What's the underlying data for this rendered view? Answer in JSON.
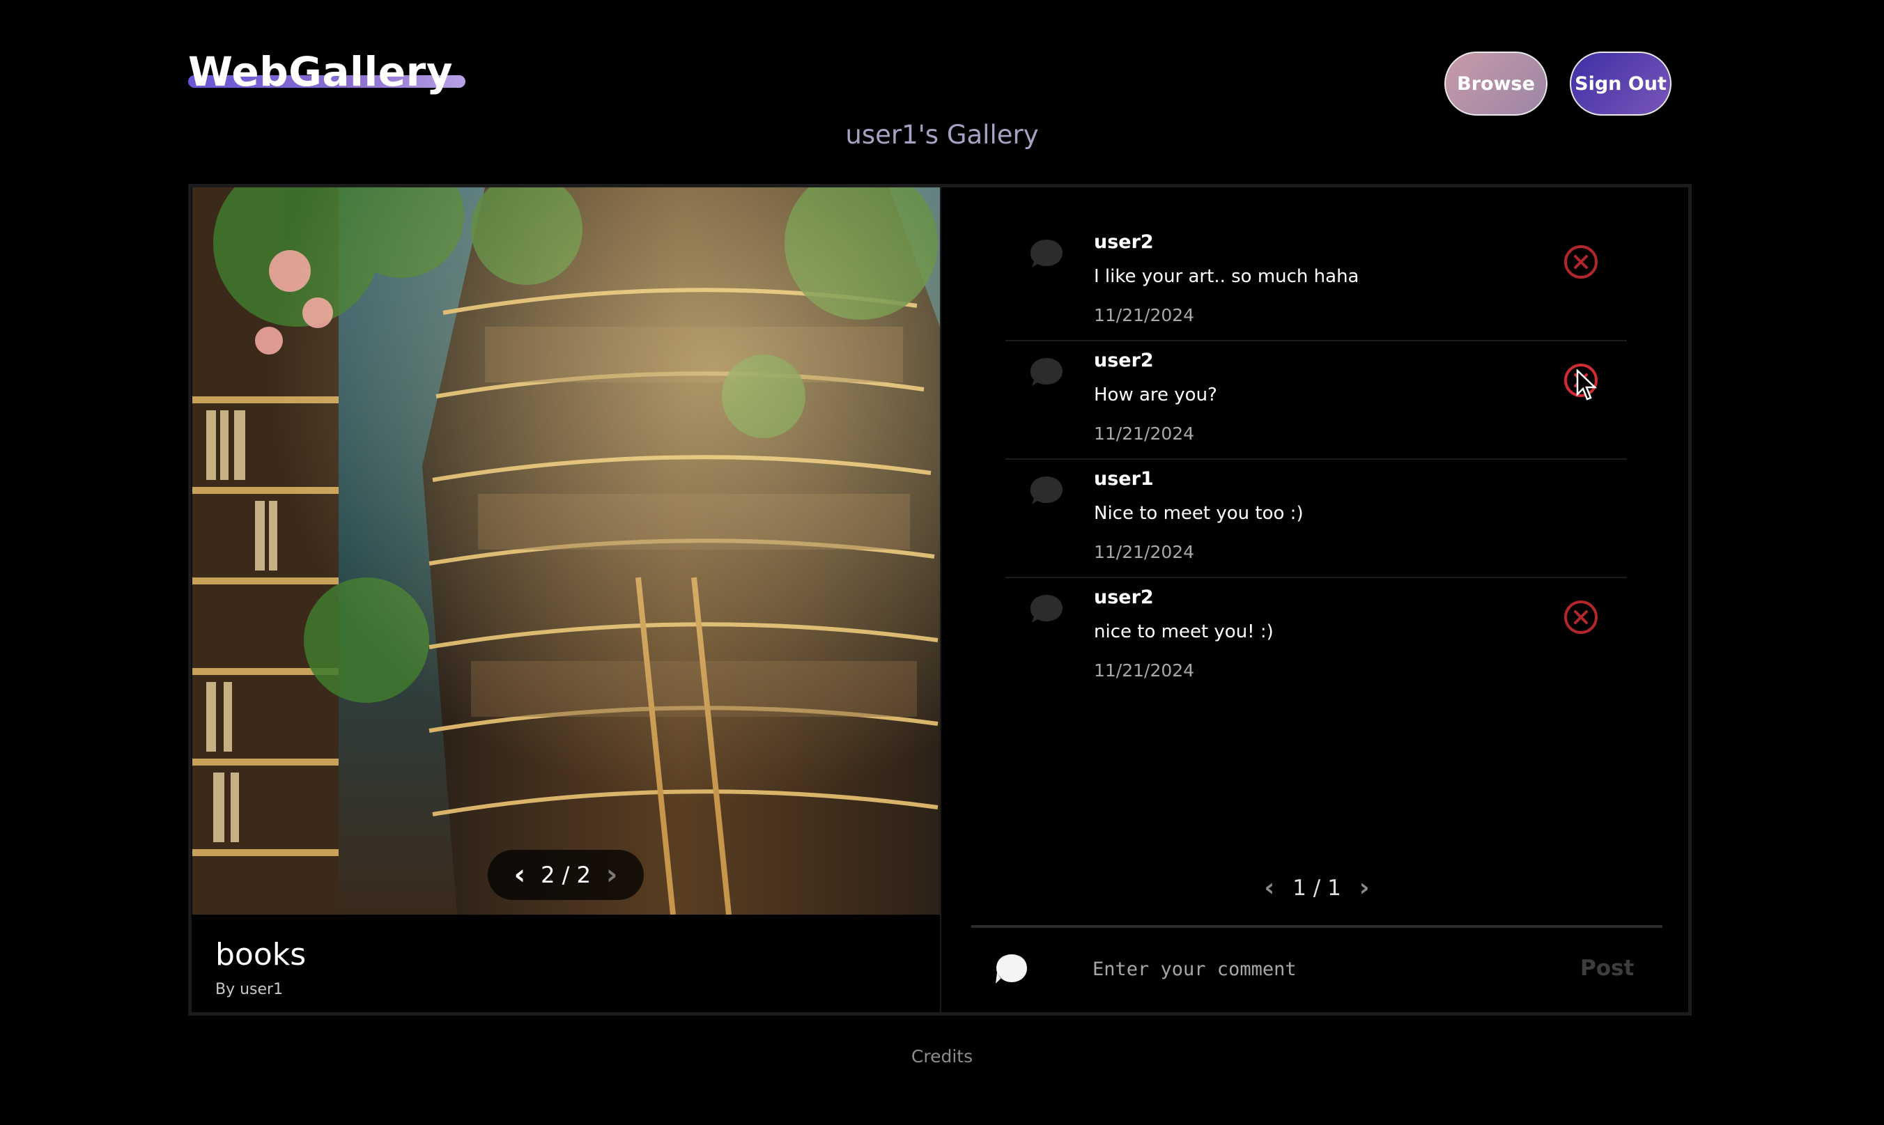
{
  "header": {
    "logo": "WebGallery",
    "browse_label": "Browse",
    "signout_label": "Sign Out",
    "gallery_title": "user1's Gallery"
  },
  "image": {
    "title": "books",
    "author": "By user1",
    "position": "2 / 2"
  },
  "comments": [
    {
      "author": "user2",
      "text": "I like your art.. so much haha",
      "date": "11/21/2024",
      "deletable": true
    },
    {
      "author": "user2",
      "text": "How are you?",
      "date": "11/21/2024",
      "deletable": true
    },
    {
      "author": "user1",
      "text": "Nice to meet you too :)",
      "date": "11/21/2024",
      "deletable": false
    },
    {
      "author": "user2",
      "text": "nice to meet you! :)",
      "date": "11/21/2024",
      "deletable": true
    }
  ],
  "comment_pager": "1 / 1",
  "comment_form": {
    "placeholder": "Enter your comment",
    "post_label": "Post"
  },
  "footer": {
    "credits": "Credits"
  },
  "colors": {
    "delete": "#b3262b",
    "gallery_title": "#a9a1c3"
  }
}
